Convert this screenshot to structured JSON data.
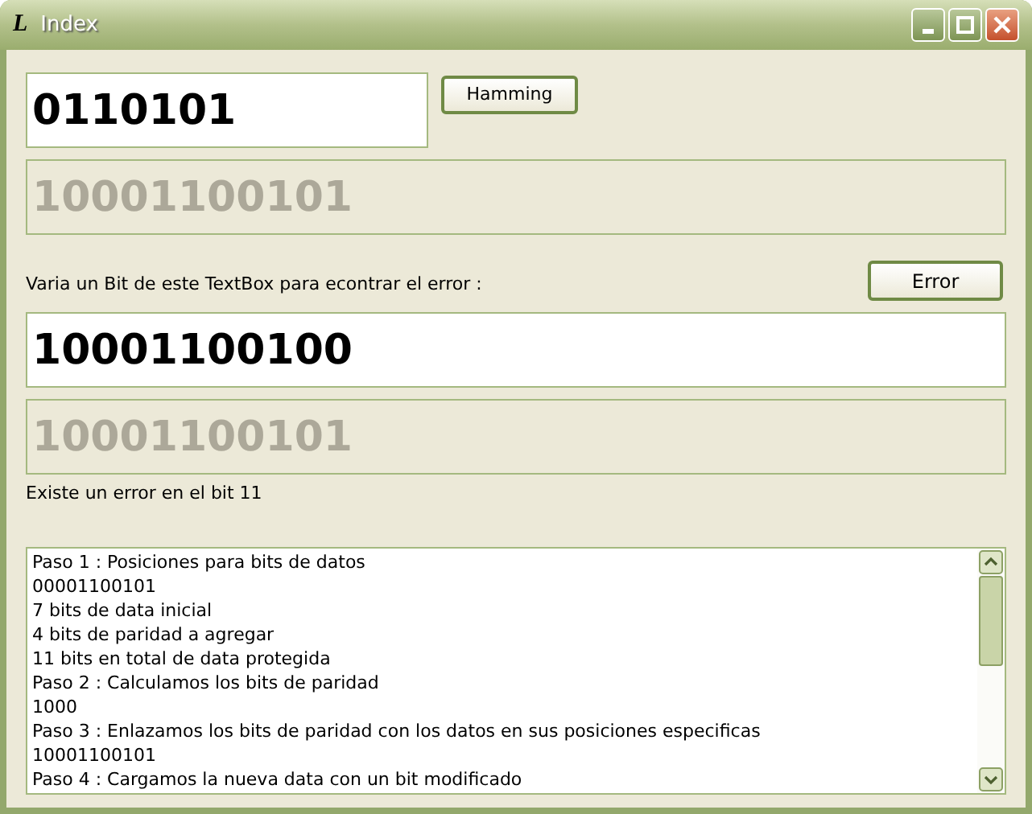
{
  "window": {
    "icon": "L",
    "title": "Index"
  },
  "input": {
    "value": "0110101",
    "disabled": false
  },
  "hamming_button": {
    "label": "Hamming"
  },
  "hamming_output": {
    "value": "10001100101",
    "disabled": true
  },
  "error_button": {
    "label": "Error"
  },
  "prompt": "Varia un Bit de este TextBox para econtrar el error :",
  "modified_input": {
    "value": "10001100100",
    "disabled": false
  },
  "corrected_output": {
    "value": "10001100101",
    "disabled": true
  },
  "result": "Existe un error en el bit 11",
  "log": [
    "Paso 1 : Posiciones para bits de datos",
    "00001100101",
    "7 bits de data inicial",
    "4 bits de paridad a agregar",
    "11 bits en total de data protegida",
    "Paso 2 : Calculamos los bits de paridad",
    "1000",
    "Paso 3 : Enlazamos los bits de paridad con los datos en sus posiciones especificas",
    "10001100101",
    "Paso 4 : Cargamos la nueva data con un bit modificado"
  ]
}
